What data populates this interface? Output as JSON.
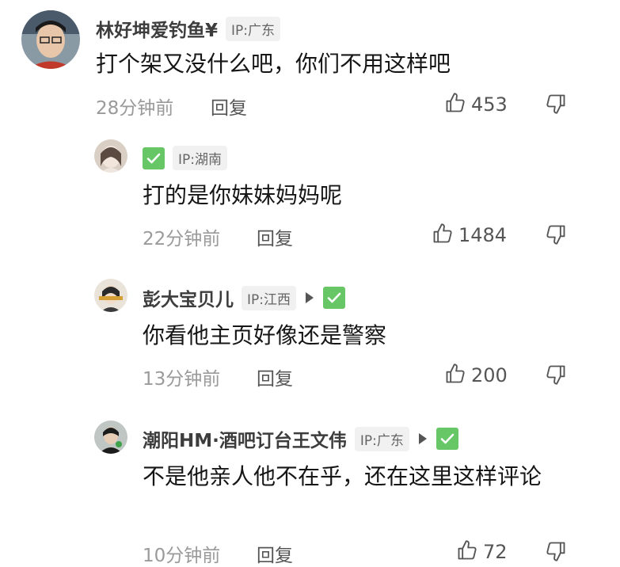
{
  "comments": [
    {
      "username": "林好坤爱钓鱼¥",
      "ip": "IP:广东",
      "text": "打个架又没什么吧，你们不用这样吧",
      "time": "28分钟前",
      "reply_label": "回复",
      "likes": "453"
    },
    {
      "username": "",
      "ip": "IP:湖南",
      "text": "打的是你妹妹妈妈呢",
      "time": "22分钟前",
      "reply_label": "回复",
      "likes": "1484"
    },
    {
      "username": "彭大宝贝儿",
      "ip": "IP:江西",
      "text": "你看他主页好像还是警察",
      "time": "13分钟前",
      "reply_label": "回复",
      "likes": "200"
    },
    {
      "username": "潮阳HM·酒吧订台王文伟",
      "ip": "IP:广东",
      "text": "不是他亲人他不在乎，还在这里这样评论",
      "time": "10分钟前",
      "reply_label": "回复",
      "likes": "72"
    }
  ],
  "colors": {
    "verified": "#67c767",
    "badge_bg": "#f1f1f1",
    "muted_text": "#9a9a9a"
  },
  "icons": [
    "thumbs-up-icon",
    "thumbs-down-icon",
    "verified-check-icon",
    "play-triangle-icon"
  ]
}
